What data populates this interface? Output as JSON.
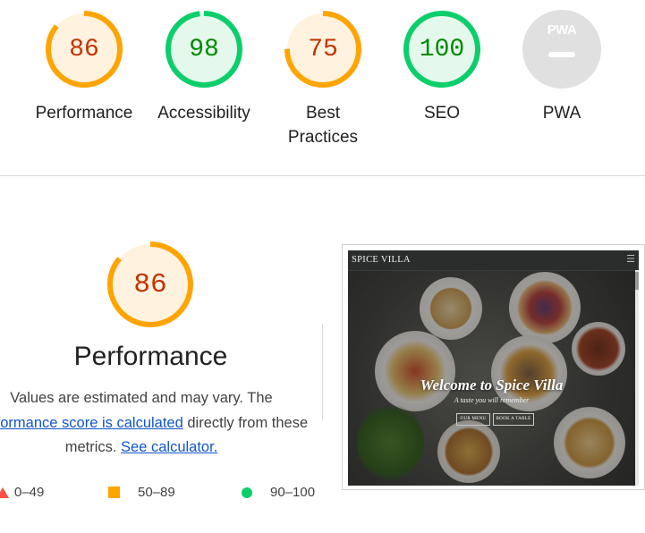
{
  "categories": [
    {
      "label": "Performance",
      "score": "86",
      "rating": "average"
    },
    {
      "label": "Accessibility",
      "score": "98",
      "rating": "pass"
    },
    {
      "label": "Best\nPractices",
      "score": "75",
      "rating": "average"
    },
    {
      "label": "SEO",
      "score": "100",
      "rating": "pass"
    },
    {
      "label": "PWA",
      "badge": "PWA",
      "rating": "na"
    }
  ],
  "colors": {
    "average_stroke": "#ffa400",
    "average_fill": "#fff3e0",
    "average_text": "#c33300",
    "pass_stroke": "#0cce6b",
    "pass_fill": "#e5f8ec",
    "pass_text": "#008800",
    "na_fill": "#e0e0e0",
    "link": "#1155cc"
  },
  "performance": {
    "score": "86",
    "title": "Performance",
    "desc_line1": "Values are estimated and may vary. The",
    "desc_link_calc": "performance score is calculated",
    "desc_line2_rest": " directly from these",
    "desc_line3_prefix": "metrics. ",
    "desc_link_calculator": "See calculator.",
    "legend": {
      "fail": "0–49",
      "average": "50–89",
      "pass": "90–100"
    }
  },
  "screenshot": {
    "brand": "SPICE VILLA",
    "menu_icon": "hamburger-icon",
    "hero_title": "Welcome to Spice Villa",
    "hero_subtitle": "A taste you will remember",
    "btn_menu": "OUR MENU",
    "btn_book": "BOOK A TABLE"
  }
}
